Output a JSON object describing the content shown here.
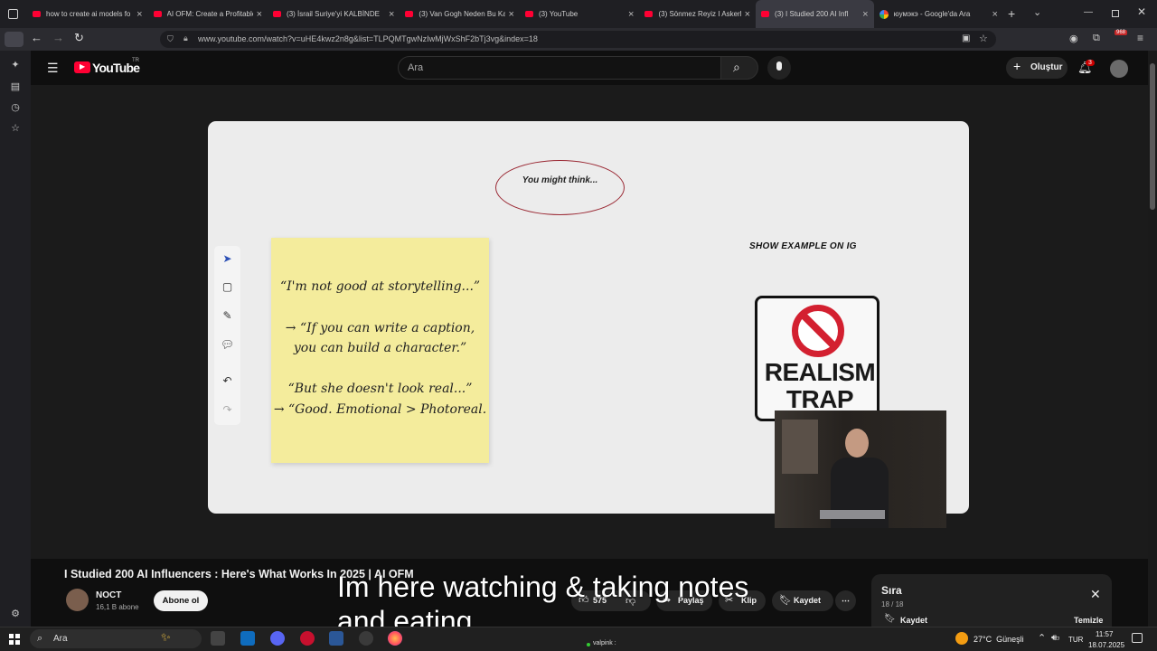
{
  "browser": {
    "tabs": [
      {
        "title": "how to create ai models fo",
        "active": false,
        "favicon": "youtube"
      },
      {
        "title": "AI OFM: Create a Profitable",
        "active": false,
        "favicon": "youtube"
      },
      {
        "title": "(3) İsrail Suriye'yi KALBİNDE",
        "active": false,
        "favicon": "youtube"
      },
      {
        "title": "(3) Van Gogh Neden Bu Ka",
        "active": false,
        "favicon": "youtube"
      },
      {
        "title": "(3) YouTube",
        "active": false,
        "favicon": "youtube"
      },
      {
        "title": "(3) Sönmez Reyiz I Askerlik",
        "active": false,
        "favicon": "youtube"
      },
      {
        "title": "(3) I Studied 200 AI Infl",
        "active": true,
        "favicon": "youtube"
      },
      {
        "title": "юумэкэ - Google'da Ara",
        "active": false,
        "favicon": "google"
      }
    ],
    "url": "www.youtube.com/watch?v=uHE4kwz2n8g&list=TLPQMTgwNzIwMjWxShF2bTj3vg&index=18",
    "profile_badge": "968"
  },
  "youtube": {
    "logo": "YouTube",
    "region": "TR",
    "search_placeholder": "Ara",
    "create_label": "Oluştur",
    "notif_count": "3"
  },
  "slide": {
    "bubble_text": "You might think...",
    "show_example": "SHOW EXAMPLE ON IG",
    "note_lines": [
      "“I'm not good at storytelling...”",
      "→ “If you can write a caption,",
      "you can build a character.”",
      "“But she doesn't look real...”",
      "→ “Good. Emotional > Photoreal."
    ],
    "sign_line1": "REALISM",
    "sign_line2": "TRAP"
  },
  "video": {
    "title": "I Studied 200 AI Influencers : Here's What Works In 2025 | AI OFM",
    "channel": "NOCT",
    "subscribers": "16,1 B abone",
    "subscribe_label": "Abone ol",
    "likes": "575",
    "share_label": "Paylaş",
    "clip_label": "Klip",
    "save_label": "Kaydet",
    "overlay_line1": "Im here watching & taking notes",
    "overlay_line2": "and eating"
  },
  "queue": {
    "title": "Sıra",
    "position": "18 / 18",
    "save_label": "Kaydet",
    "clear_label": "Temizle"
  },
  "taskbar": {
    "search_placeholder": "Ara",
    "app_label": "valpink :",
    "weather": "27°C  Güneşli",
    "lang": "TUR",
    "time": "11:57",
    "date": "18.07.2025"
  }
}
